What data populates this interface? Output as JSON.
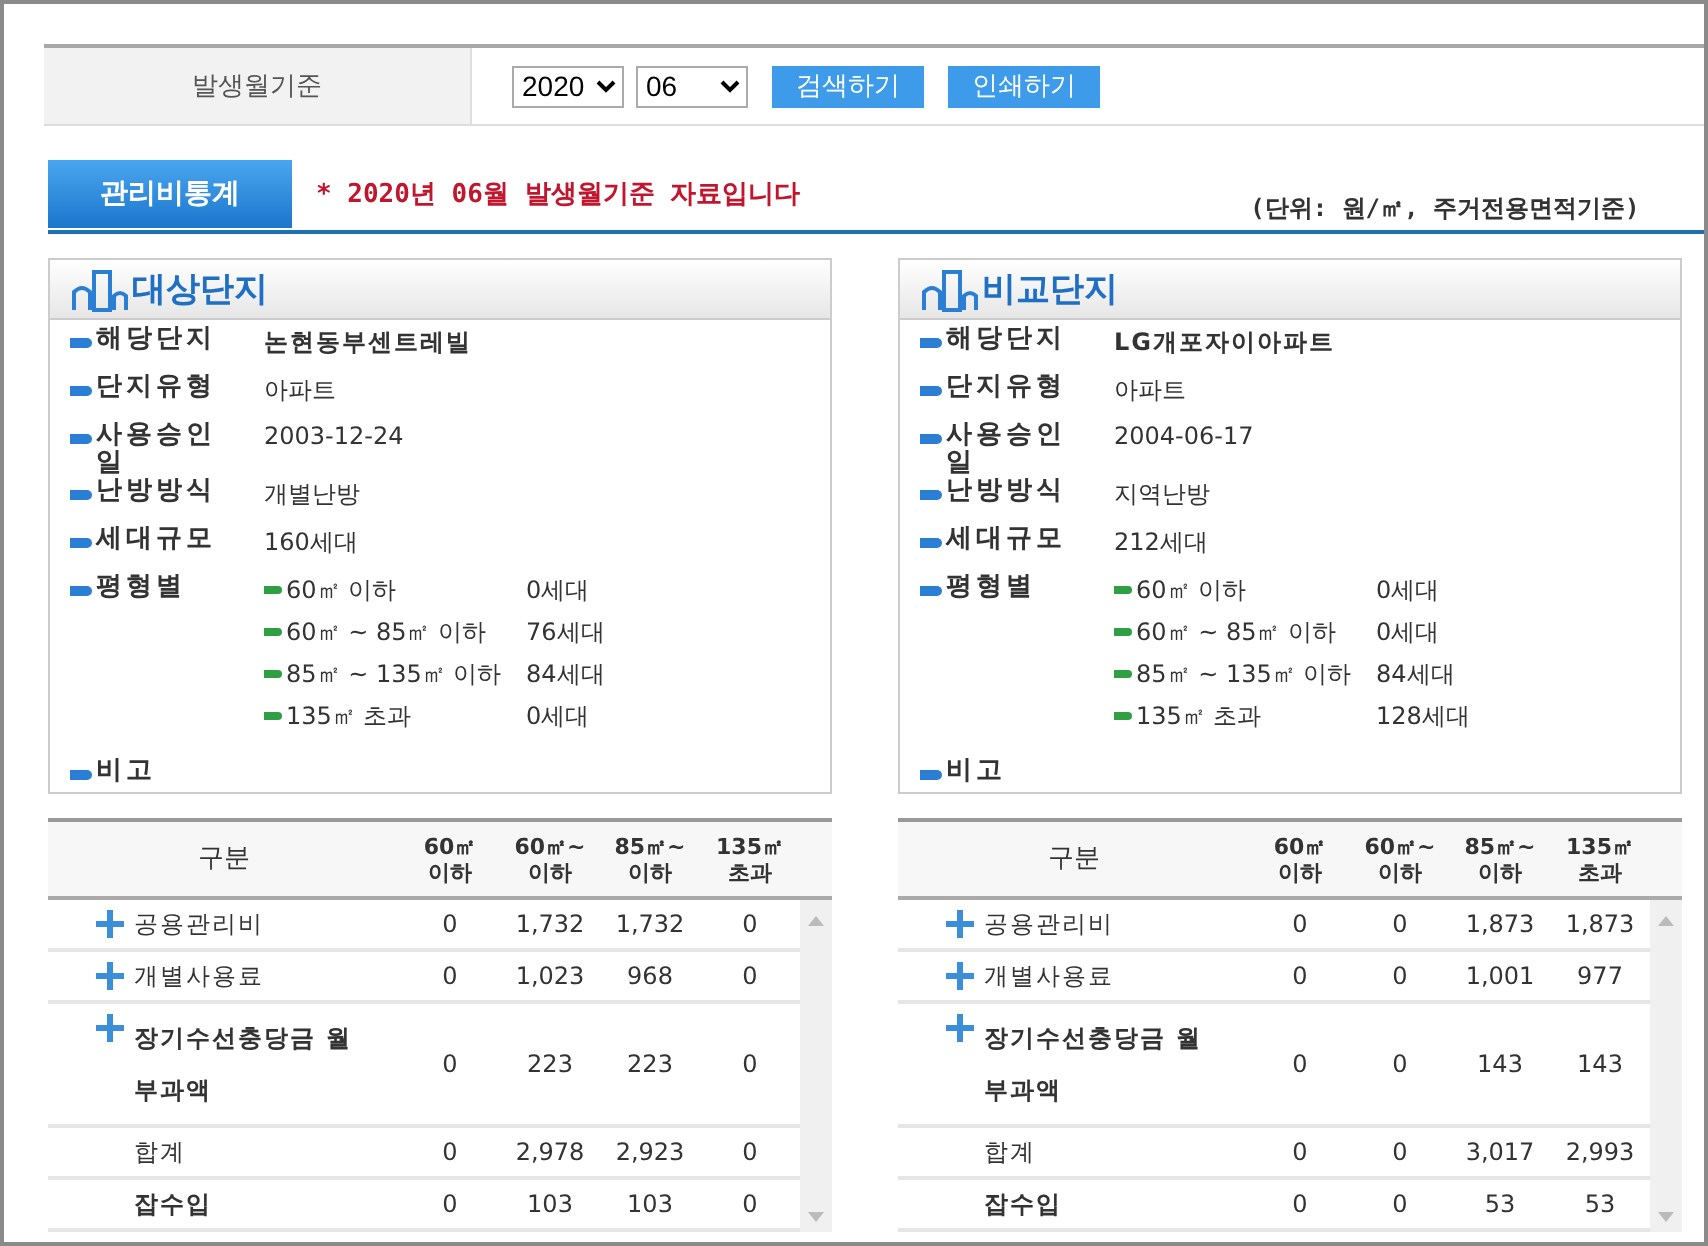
{
  "filter": {
    "label": "발생월기준",
    "year": "2020",
    "month": "06",
    "buttons": [
      "검색하기",
      "인쇄하기"
    ]
  },
  "header": {
    "tab": "관리비통계",
    "notice": "* 2020년 06월 발생월기준 자료입니다",
    "unit": "(단위: 원/㎡, 주거전용면적기준)"
  },
  "panels": [
    {
      "title": "대상단지",
      "info": [
        {
          "label": "해당단지",
          "value": "논현동부센트레빌",
          "bold": true
        },
        {
          "label": "단지유형",
          "value": "아파트",
          "bold": false
        },
        {
          "label": "사용승인일",
          "value": "2003-12-24",
          "bold": false
        },
        {
          "label": "난방방식",
          "value": "개별난방",
          "bold": false
        },
        {
          "label": "세대규모",
          "value": "160세대",
          "bold": false
        }
      ],
      "size_label": "평형별",
      "sizes": [
        {
          "label": "60㎡ 이하",
          "value": "0세대"
        },
        {
          "label": "60㎡ ~ 85㎡ 이하",
          "value": "76세대"
        },
        {
          "label": "85㎡ ~ 135㎡ 이하",
          "value": "84세대"
        },
        {
          "label": "135㎡ 초과",
          "value": "0세대"
        }
      ],
      "remark_label": "비고"
    },
    {
      "title": "비교단지",
      "info": [
        {
          "label": "해당단지",
          "value": "LG개포자이아파트",
          "bold": true
        },
        {
          "label": "단지유형",
          "value": "아파트",
          "bold": false
        },
        {
          "label": "사용승인일",
          "value": "2004-06-17",
          "bold": false
        },
        {
          "label": "난방방식",
          "value": "지역난방",
          "bold": false
        },
        {
          "label": "세대규모",
          "value": "212세대",
          "bold": false
        }
      ],
      "size_label": "평형별",
      "sizes": [
        {
          "label": "60㎡ 이하",
          "value": "0세대"
        },
        {
          "label": "60㎡ ~ 85㎡ 이하",
          "value": "0세대"
        },
        {
          "label": "85㎡ ~ 135㎡ 이하",
          "value": "84세대"
        },
        {
          "label": "135㎡ 초과",
          "value": "128세대"
        }
      ],
      "remark_label": "비고"
    }
  ],
  "tables": [
    {
      "columns": [
        "구분",
        "60㎡\n이하",
        "60㎡~\n이하",
        "85㎡~\n이하",
        "135㎡\n초과"
      ],
      "rows": [
        {
          "label": "공용관리비",
          "expandable": true,
          "bold": false,
          "values": [
            "0",
            "1,732",
            "1,732",
            "0"
          ]
        },
        {
          "label": "개별사용료",
          "expandable": true,
          "bold": false,
          "values": [
            "0",
            "1,023",
            "968",
            "0"
          ]
        },
        {
          "label": "장기수선충당금 월 부과액",
          "expandable": true,
          "bold": true,
          "values": [
            "0",
            "223",
            "223",
            "0"
          ]
        },
        {
          "label": "합계",
          "expandable": false,
          "bold": false,
          "values": [
            "0",
            "2,978",
            "2,923",
            "0"
          ]
        },
        {
          "label": "잡수입",
          "expandable": false,
          "bold": true,
          "values": [
            "0",
            "103",
            "103",
            "0"
          ]
        }
      ]
    },
    {
      "columns": [
        "구분",
        "60㎡\n이하",
        "60㎡~\n이하",
        "85㎡~\n이하",
        "135㎡\n초과"
      ],
      "rows": [
        {
          "label": "공용관리비",
          "expandable": true,
          "bold": false,
          "values": [
            "0",
            "0",
            "1,873",
            "1,873"
          ]
        },
        {
          "label": "개별사용료",
          "expandable": true,
          "bold": false,
          "values": [
            "0",
            "0",
            "1,001",
            "977"
          ]
        },
        {
          "label": "장기수선충당금 월 부과액",
          "expandable": true,
          "bold": true,
          "values": [
            "0",
            "0",
            "143",
            "143"
          ]
        },
        {
          "label": "합계",
          "expandable": false,
          "bold": false,
          "values": [
            "0",
            "0",
            "3,017",
            "2,993"
          ]
        },
        {
          "label": "잡수입",
          "expandable": false,
          "bold": true,
          "values": [
            "0",
            "0",
            "53",
            "53"
          ]
        }
      ]
    }
  ]
}
